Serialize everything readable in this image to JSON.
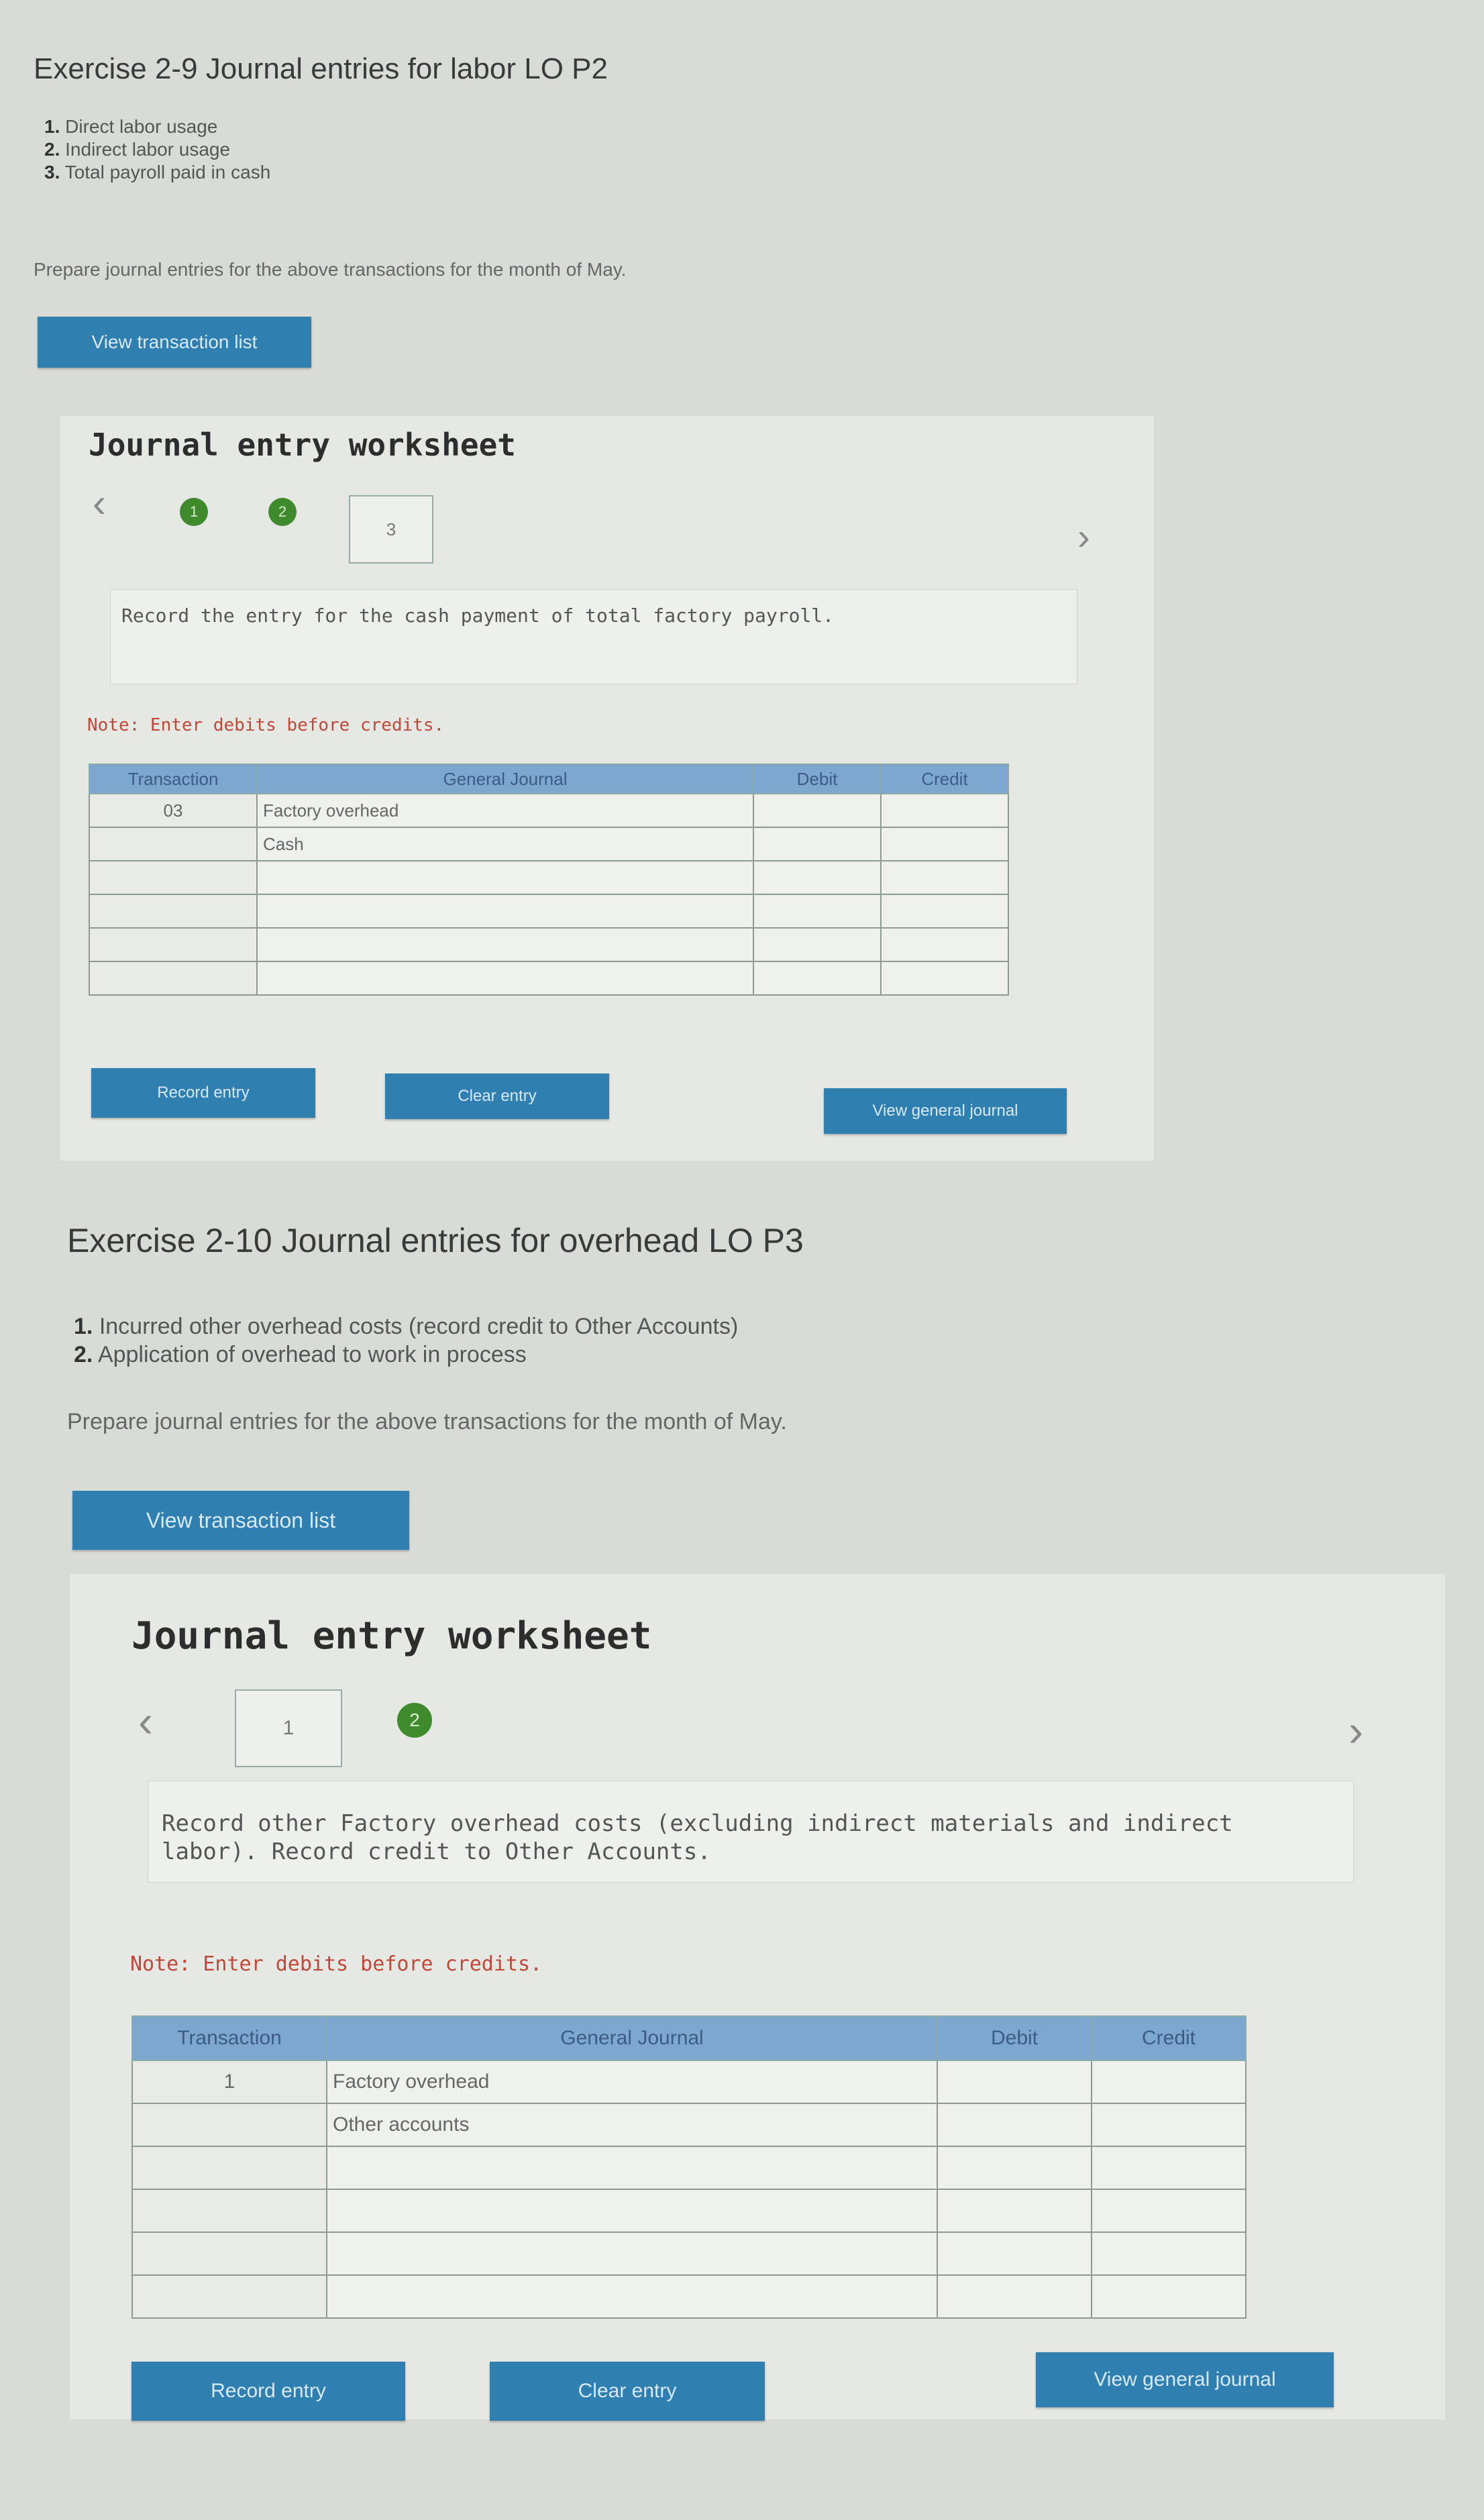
{
  "ex1": {
    "title": "Exercise 2-9 Journal entries for labor LO P2",
    "items": [
      {
        "num": "1.",
        "text": "Direct labor usage"
      },
      {
        "num": "2.",
        "text": "Indirect labor usage"
      },
      {
        "num": "3.",
        "text": "Total payroll paid in cash"
      }
    ],
    "prompt": "Prepare journal entries for the above transactions for the month of May.",
    "view_transaction_list": "View transaction list",
    "worksheet": {
      "title": "Journal entry worksheet",
      "prev_arrow": "‹",
      "next_arrow": "›",
      "steps": [
        "1",
        "2",
        "3"
      ],
      "instruction": "Record the entry for the cash payment of total factory payroll.",
      "note": "Note: Enter debits before credits.",
      "table": {
        "headers": [
          "Transaction",
          "General Journal",
          "Debit",
          "Credit"
        ],
        "rows": [
          {
            "transaction": "03",
            "account": "Factory overhead",
            "debit": "",
            "credit": ""
          },
          {
            "transaction": "",
            "account": "Cash",
            "debit": "",
            "credit": ""
          },
          {
            "transaction": "",
            "account": "",
            "debit": "",
            "credit": ""
          },
          {
            "transaction": "",
            "account": "",
            "debit": "",
            "credit": ""
          },
          {
            "transaction": "",
            "account": "",
            "debit": "",
            "credit": ""
          },
          {
            "transaction": "",
            "account": "",
            "debit": "",
            "credit": ""
          }
        ]
      },
      "record_entry": "Record entry",
      "clear_entry": "Clear entry",
      "view_general_journal": "View general journal"
    }
  },
  "ex2": {
    "title": "Exercise 2-10 Journal entries for overhead LO P3",
    "items": [
      {
        "num": "1.",
        "text": "Incurred other overhead costs (record credit to Other Accounts)"
      },
      {
        "num": "2.",
        "text": "Application of overhead to work in process"
      }
    ],
    "prompt": "Prepare journal entries for the above transactions for the month of May.",
    "view_transaction_list": "View transaction list",
    "worksheet": {
      "title": "Journal entry worksheet",
      "prev_arrow": "‹",
      "next_arrow": "›",
      "steps": [
        "1",
        "2"
      ],
      "instruction": "Record other Factory overhead costs (excluding indirect materials and indirect labor). Record credit to Other Accounts.",
      "note": "Note: Enter debits before credits.",
      "table": {
        "headers": [
          "Transaction",
          "General Journal",
          "Debit",
          "Credit"
        ],
        "rows": [
          {
            "transaction": "1",
            "account": "Factory overhead",
            "debit": "",
            "credit": ""
          },
          {
            "transaction": "",
            "account": "Other accounts",
            "debit": "",
            "credit": ""
          },
          {
            "transaction": "",
            "account": "",
            "debit": "",
            "credit": ""
          },
          {
            "transaction": "",
            "account": "",
            "debit": "",
            "credit": ""
          },
          {
            "transaction": "",
            "account": "",
            "debit": "",
            "credit": ""
          },
          {
            "transaction": "",
            "account": "",
            "debit": "",
            "credit": ""
          }
        ]
      },
      "record_entry": "Record entry",
      "clear_entry": "Clear entry",
      "view_general_journal": "View general journal"
    }
  }
}
